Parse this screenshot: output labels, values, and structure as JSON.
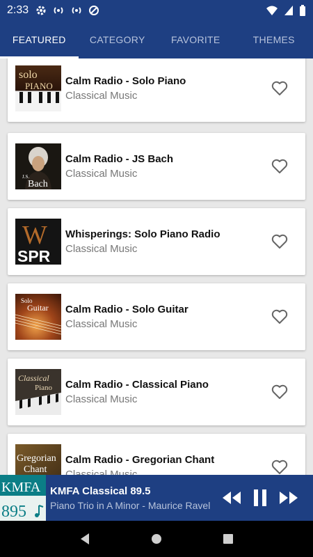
{
  "status": {
    "time": "2:33"
  },
  "tabs": [
    {
      "label": "FEATURED"
    },
    {
      "label": "CATEGORY"
    },
    {
      "label": "FAVORITE"
    },
    {
      "label": "THEMES"
    }
  ],
  "stations": [
    {
      "title": "Calm Radio - Solo Piano",
      "subtitle": "Classical Music",
      "thumb_text": "solo\nPIANO",
      "icon": "heart-outline-icon"
    },
    {
      "title": "Calm Radio - JS Bach",
      "subtitle": "Classical Music",
      "thumb_text": "J.S. Bach",
      "icon": "heart-outline-icon"
    },
    {
      "title": "Whisperings: Solo Piano Radio",
      "subtitle": "Classical Music",
      "thumb_text": "W SPR",
      "icon": "heart-outline-icon"
    },
    {
      "title": "Calm Radio - Solo Guitar",
      "subtitle": "Classical Music",
      "thumb_text": "Solo Guitar",
      "icon": "heart-outline-icon"
    },
    {
      "title": "Calm Radio - Classical Piano",
      "subtitle": "Classical Music",
      "thumb_text": "Classical Piano",
      "icon": "heart-outline-icon"
    },
    {
      "title": "Calm Radio - Gregorian Chant",
      "subtitle": "Classical Music",
      "thumb_text": "Gregorian Chant",
      "icon": "heart-outline-icon"
    }
  ],
  "player": {
    "station": "KMFA Classical 89.5",
    "track": "Piano Trio in A Minor - Maurice Ravel",
    "art_top": "KMFA",
    "art_bottom": "895"
  },
  "colors": {
    "primary": "#1e3f82",
    "background": "#e8e8e8",
    "art": "#0b7e86"
  }
}
